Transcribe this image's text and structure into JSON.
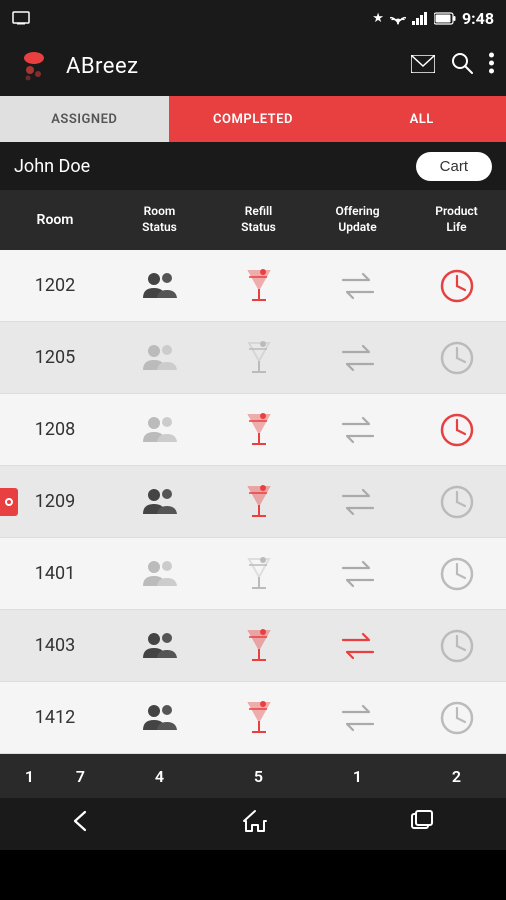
{
  "statusBar": {
    "time": "9:48",
    "icons": [
      "bluetooth",
      "wifi",
      "signal",
      "battery"
    ]
  },
  "appBar": {
    "title": "ABreez",
    "actions": [
      "mail",
      "search",
      "more"
    ]
  },
  "tabs": [
    {
      "id": "assigned",
      "label": "ASSIGNED",
      "active": false
    },
    {
      "id": "completed",
      "label": "COMPLETED",
      "active": true
    },
    {
      "id": "all",
      "label": "ALL",
      "active": false
    }
  ],
  "userRow": {
    "name": "John Doe",
    "cartLabel": "Cart"
  },
  "tableHeader": {
    "room": "Room",
    "roomStatus": "Room\nStatus",
    "refillStatus": "Refill\nStatus",
    "offeringUpdate": "Offering\nUpdate",
    "productLife": "Product\nLife"
  },
  "rows": [
    {
      "room": "1202",
      "roomStatus": "dark",
      "refillStatus": "red",
      "offeringUpdate": "gray",
      "productLife": "red",
      "doorHanger": false,
      "bg": "light"
    },
    {
      "room": "1205",
      "roomStatus": "light",
      "refillStatus": "light",
      "offeringUpdate": "gray",
      "productLife": "light",
      "doorHanger": false,
      "bg": "dark"
    },
    {
      "room": "1208",
      "roomStatus": "light",
      "refillStatus": "red",
      "offeringUpdate": "gray",
      "productLife": "red",
      "doorHanger": false,
      "bg": "light"
    },
    {
      "room": "1209",
      "roomStatus": "dark",
      "refillStatus": "red",
      "offeringUpdate": "gray",
      "productLife": "light",
      "doorHanger": true,
      "bg": "dark"
    },
    {
      "room": "1401",
      "roomStatus": "light",
      "refillStatus": "light",
      "offeringUpdate": "gray",
      "productLife": "light",
      "doorHanger": false,
      "bg": "light"
    },
    {
      "room": "1403",
      "roomStatus": "dark",
      "refillStatus": "red",
      "offeringUpdate": "red",
      "productLife": "light",
      "doorHanger": false,
      "bg": "dark"
    },
    {
      "room": "1412",
      "roomStatus": "dark",
      "refillStatus": "red",
      "offeringUpdate": "gray",
      "productLife": "light",
      "doorHanger": false,
      "bg": "light"
    }
  ],
  "summaryBar": {
    "roomCount1": "1",
    "roomCount2": "7",
    "col1": "4",
    "col2": "5",
    "col3": "1",
    "col4": "2"
  },
  "bottomNav": {
    "back": "←",
    "home": "⌂",
    "recent": "▣"
  }
}
